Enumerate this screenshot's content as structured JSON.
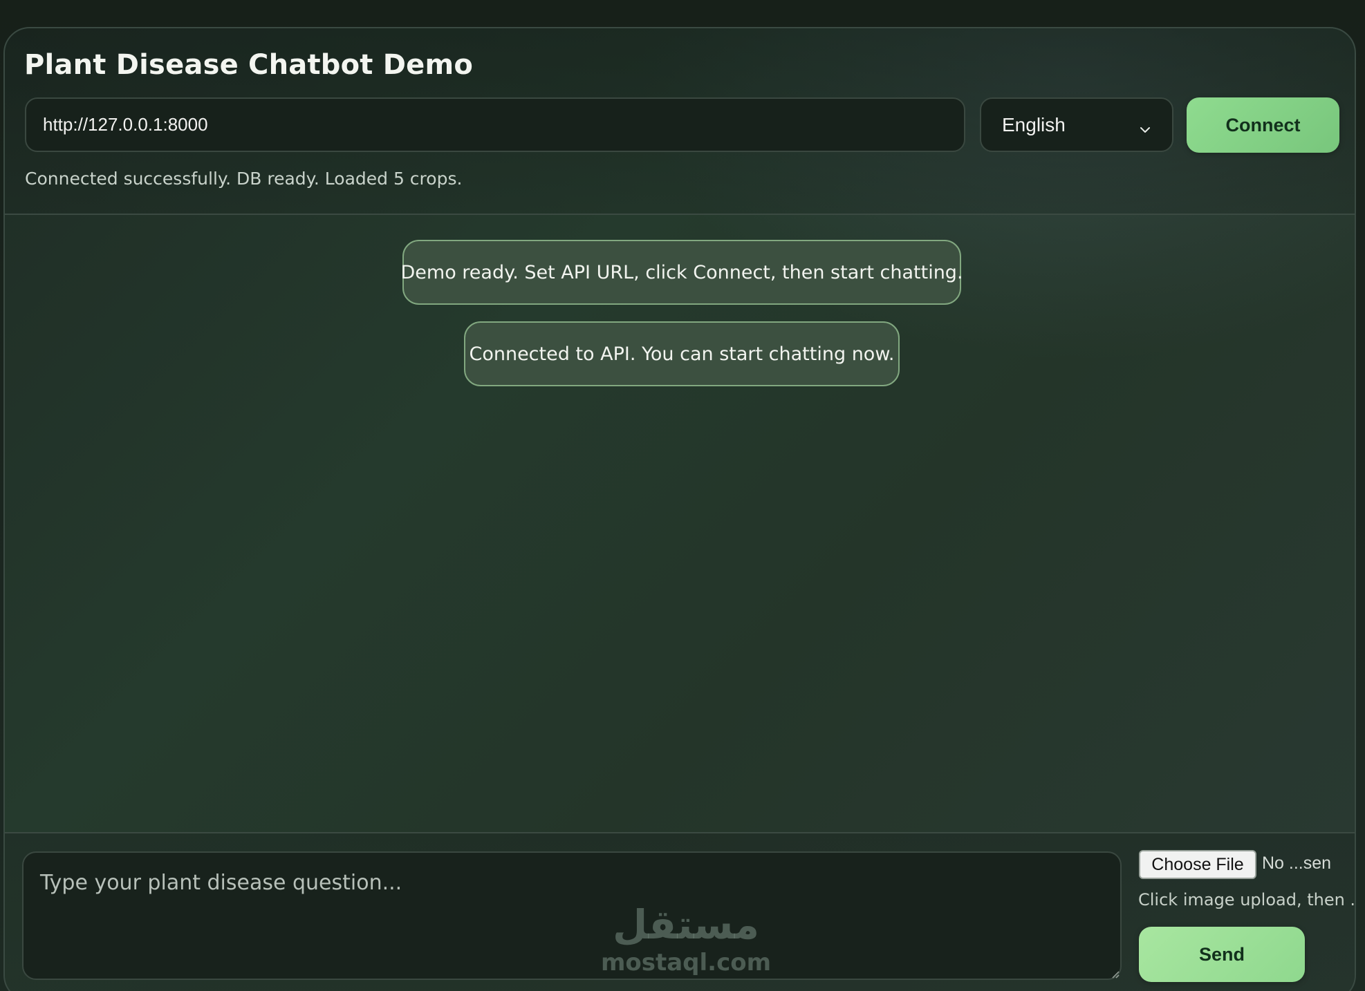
{
  "header": {
    "title": "Plant Disease Chatbot Demo",
    "api_url_value": "http://127.0.0.1:8000",
    "language_selected": "English",
    "connect_label": "Connect",
    "status_text": "Connected successfully. DB ready. Loaded 5 crops."
  },
  "chat": {
    "messages": [
      {
        "role": "system",
        "text": "Demo ready. Set API URL, click Connect, then start chatting."
      },
      {
        "role": "system",
        "text": "Connected to API. You can start chatting now."
      }
    ]
  },
  "composer": {
    "placeholder": "Type your plant disease question...",
    "choose_file_label": "Choose File",
    "file_status": "No ...sen",
    "upload_hint": "Click image upload, then ...",
    "send_label": "Send"
  },
  "watermark": {
    "arabic": "مستقل",
    "latin": "mostaql.com"
  },
  "colors": {
    "accent_green": "#8fdb8f",
    "bubble_bg": "#3c5040",
    "bubble_border": "#82a880",
    "panel_bg": "#243529"
  },
  "icons": {
    "language_dropdown": "chevron-down-icon",
    "textarea_resize": "resize-grip-icon"
  }
}
